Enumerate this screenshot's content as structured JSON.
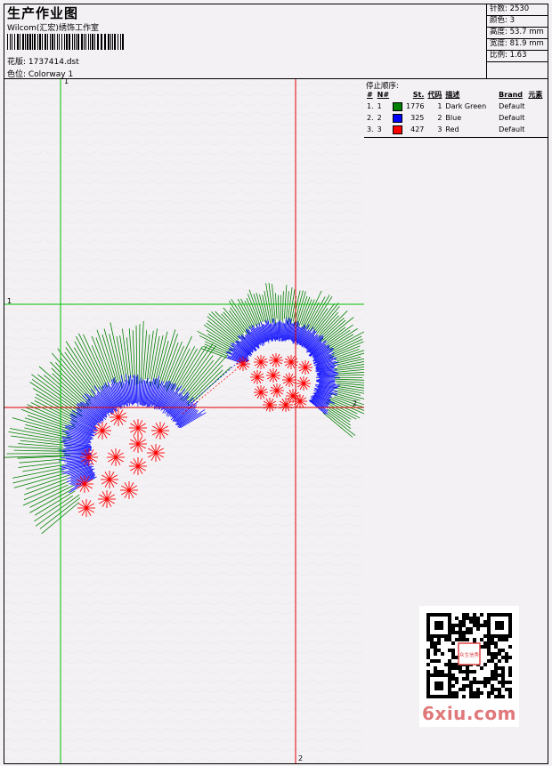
{
  "header": {
    "title": "生产作业图",
    "studio": "Wilcom(汇宏)绣饰工作室",
    "design_file": "花版: 1737414.dst",
    "colorway": "色位: Colorway 1"
  },
  "stats": {
    "stitches": "针数: 2530",
    "colors": "颜色: 3",
    "height": "高度: 53.7 mm",
    "width": "宽度: 81.9 mm",
    "scale": "比例: 1.63"
  },
  "stop_sequence": {
    "title": "停止顺序:",
    "columns": [
      "#",
      "N#",
      "St.",
      "代码",
      "描述",
      "Brand",
      "元素"
    ],
    "rows": [
      {
        "index": "1.",
        "n": "1",
        "stitches": "1776",
        "code": "1",
        "description": "Dark Green",
        "brand": "Default",
        "color": "#008000"
      },
      {
        "index": "2.",
        "n": "2",
        "stitches": "325",
        "code": "2",
        "description": "Blue",
        "brand": "Default",
        "color": "#0000ff"
      },
      {
        "index": "3.",
        "n": "3",
        "stitches": "427",
        "code": "3",
        "description": "Red",
        "brand": "Default",
        "color": "#ff0000"
      }
    ]
  },
  "guides": {
    "green_v_label": "1",
    "green_h_label": "1",
    "red_h_label": "2",
    "red_v_label": "2"
  },
  "watermark": "6xiu.com",
  "qr_stamp": "众生信秀",
  "colors": {
    "green": "#008000",
    "blue": "#0000ff",
    "red": "#ff0000",
    "guide_green": "#00c000",
    "guide_red": "#e00000"
  }
}
